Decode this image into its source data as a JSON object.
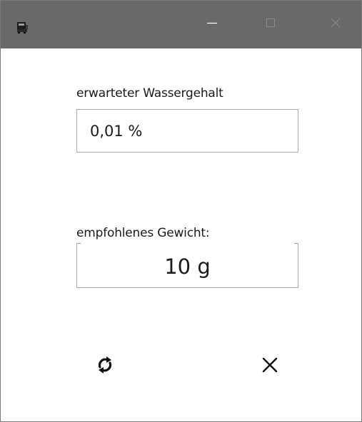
{
  "window": {
    "title_icon": "app-icon",
    "controls": {
      "minimize_icon": "minimize-icon",
      "maximize_icon": "maximize-icon",
      "close_icon": "close-icon"
    },
    "titlebar_color": "#696969"
  },
  "form": {
    "water_label": "erwarteter Wassergehalt",
    "water_value": "0,01 %",
    "weight_label": "empfohlenes Gewicht:",
    "weight_value": "10 g"
  },
  "actions": {
    "refresh_icon": "refresh-icon",
    "cancel_icon": "cancel-icon"
  }
}
